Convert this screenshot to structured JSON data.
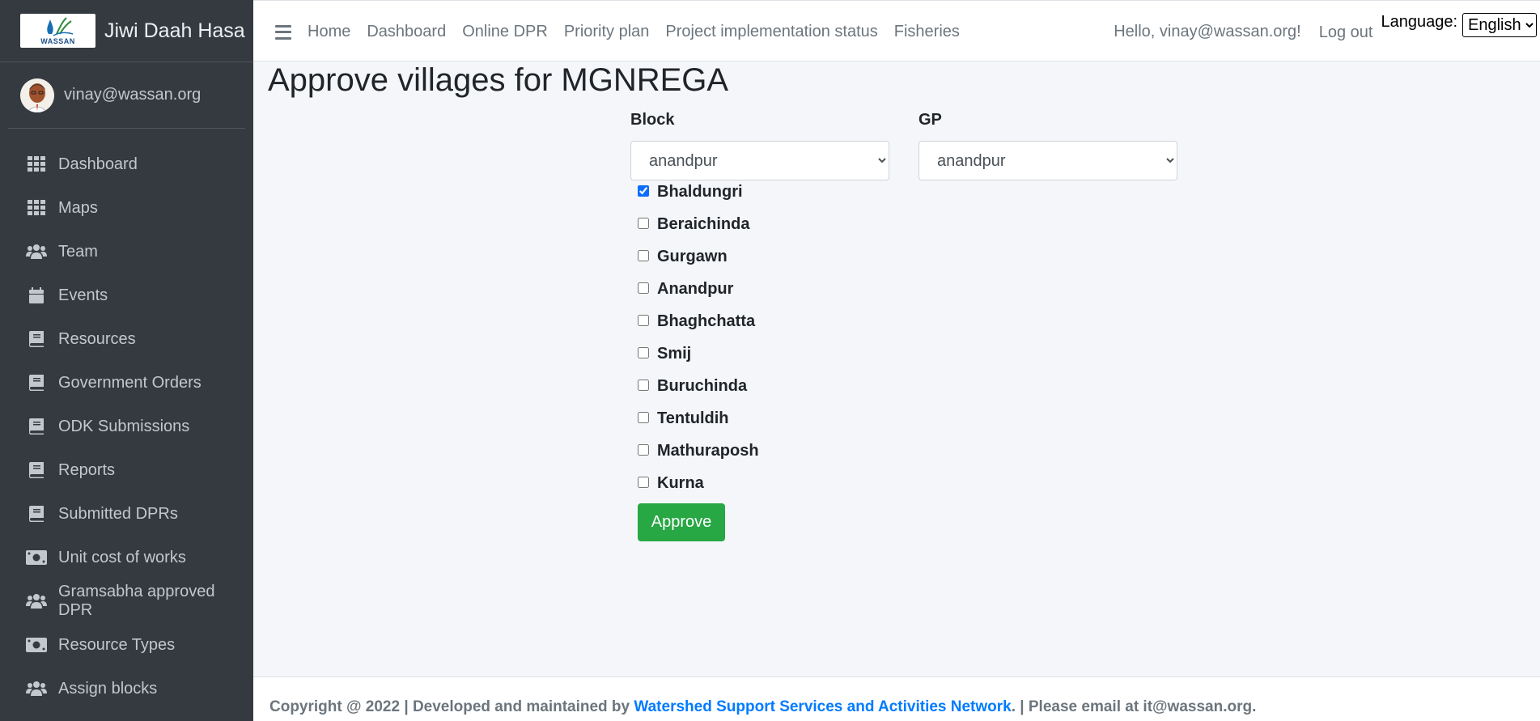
{
  "brand": {
    "name": "Jiwi Daah Hasa",
    "logo_text": "WASSAN"
  },
  "user": {
    "email": "vinay@wassan.org"
  },
  "sidebar": {
    "items": [
      {
        "label": "Dashboard",
        "icon": "grid-icon"
      },
      {
        "label": "Maps",
        "icon": "grid-icon"
      },
      {
        "label": "Team",
        "icon": "users-icon"
      },
      {
        "label": "Events",
        "icon": "calendar-icon"
      },
      {
        "label": "Resources",
        "icon": "book-icon"
      },
      {
        "label": "Government Orders",
        "icon": "book-icon"
      },
      {
        "label": "ODK Submissions",
        "icon": "book-icon"
      },
      {
        "label": "Reports",
        "icon": "book-icon"
      },
      {
        "label": "Submitted DPRs",
        "icon": "book-icon"
      },
      {
        "label": "Unit cost of works",
        "icon": "money-icon"
      },
      {
        "label": "Gramsabha approved DPR",
        "icon": "users-icon"
      },
      {
        "label": "Resource Types",
        "icon": "money-icon"
      },
      {
        "label": "Assign blocks",
        "icon": "users-icon"
      }
    ]
  },
  "topnav": {
    "links": [
      "Home",
      "Dashboard",
      "Online DPR",
      "Priority plan",
      "Project implementation status",
      "Fisheries"
    ],
    "hello": "Hello, vinay@wassan.org!",
    "logout": "Log out",
    "language_label": "Language:",
    "language_value": "English"
  },
  "page": {
    "title": "Approve villages for MGNREGA",
    "block_label": "Block",
    "block_value": "anandpur",
    "gp_label": "GP",
    "gp_value": "anandpur",
    "villages": [
      {
        "name": "Bhaldungri",
        "checked": true
      },
      {
        "name": "Beraichinda",
        "checked": false
      },
      {
        "name": "Gurgawn",
        "checked": false
      },
      {
        "name": "Anandpur",
        "checked": false
      },
      {
        "name": "Bhaghchatta",
        "checked": false
      },
      {
        "name": "Smij",
        "checked": false
      },
      {
        "name": "Buruchinda",
        "checked": false
      },
      {
        "name": "Tentuldih",
        "checked": false
      },
      {
        "name": "Mathuraposh",
        "checked": false
      },
      {
        "name": "Kurna",
        "checked": false
      }
    ],
    "approve_label": "Approve"
  },
  "footer": {
    "prefix": "Copyright @ 2022 | Developed and maintained by ",
    "link": "Watershed Support Services and Activities Network",
    "suffix": ". | Please email at it@wassan.org."
  },
  "colors": {
    "sidebar_bg": "#343a40",
    "approve_green": "#28a745",
    "link_blue": "#007bff"
  }
}
